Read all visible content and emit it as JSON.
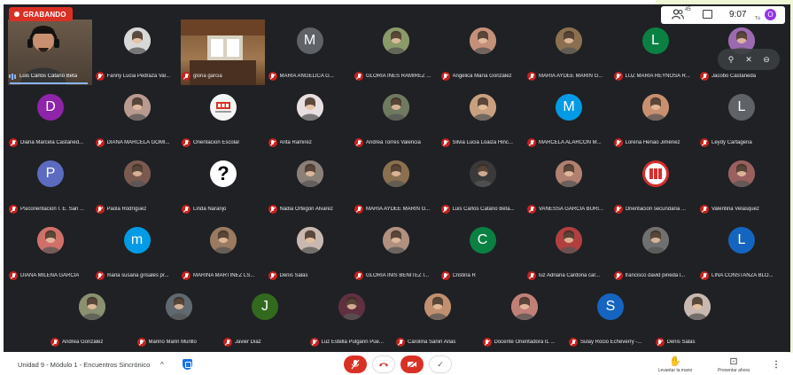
{
  "recording": {
    "label": "GRABANDO"
  },
  "topbar": {
    "participants_count": "45",
    "time": "9:07",
    "you_label": "Tú",
    "avatar_letter": "O"
  },
  "colors": {
    "background": "#202124",
    "recording": "#d93025",
    "mic_muted": "#c5221f",
    "speaking": "#8ab4f8"
  },
  "tiles": [
    {
      "name": "Luis Carlos Catano Beta",
      "avatar": "video-man-headphones",
      "color": "#5a4a3a",
      "speaking": true
    },
    {
      "name": "Fanny Lucia Pedraza Val...",
      "avatar": "photo",
      "color": "#d8d8d8"
    },
    {
      "name": "gloria garcia",
      "avatar": "video-room",
      "color": "#6b4a30"
    },
    {
      "name": "MARIA ANGELICA G...",
      "avatar": "M",
      "color": "#5f6368"
    },
    {
      "name": "GLORIA INÉS RAMÍREZ ...",
      "avatar": "photo",
      "color": "#8a9a6a"
    },
    {
      "name": "Angélica María González",
      "avatar": "photo",
      "color": "#c4907a"
    },
    {
      "name": "MARIA AYDEE MARIN G...",
      "avatar": "photo",
      "color": "#8a7050"
    },
    {
      "name": "LUZ MARIA REYNOSA R...",
      "avatar": "L",
      "color": "#0b8043"
    },
    {
      "name": "Jacobo Castañeda",
      "avatar": "photo",
      "color": "#9b6ab0"
    },
    {
      "name": "Diana Marcela Castañed...",
      "avatar": "D",
      "color": "#8e24aa"
    },
    {
      "name": "DIANA MARCELA GOMI...",
      "avatar": "photo",
      "color": "#b89a90"
    },
    {
      "name": "Orientacion Escolar",
      "avatar": "logo",
      "color": "#f4f4f4"
    },
    {
      "name": "Arita Ramirez",
      "avatar": "photo",
      "color": "#e8e0e0"
    },
    {
      "name": "Andrea Torres Valencia",
      "avatar": "photo",
      "color": "#707a60"
    },
    {
      "name": "Silvia Lucia Loaiza Hinc...",
      "avatar": "photo",
      "color": "#c8a080"
    },
    {
      "name": "MARCELA ALARCON M...",
      "avatar": "M",
      "color": "#039be5"
    },
    {
      "name": "Lorena Henao Jiménez",
      "avatar": "photo",
      "color": "#c89070"
    },
    {
      "name": "Leydy Cartagena",
      "avatar": "L",
      "color": "#5f6368"
    },
    {
      "name": "Psicorientacion I. E. San ...",
      "avatar": "P",
      "color": "#5c6bc0"
    },
    {
      "name": "Paola Rodríguez",
      "avatar": "photo",
      "color": "#7a5a50"
    },
    {
      "name": "Linda Naranjo",
      "avatar": "question",
      "color": "#ffffff"
    },
    {
      "name": "Nadia Ortegon Alvarez",
      "avatar": "photo",
      "color": "#8a8078"
    },
    {
      "name": "MARIA AYDEE MARIN G...",
      "avatar": "photo",
      "color": "#8a7050"
    },
    {
      "name": "Luis Carlos Catano Beta...",
      "avatar": "photo",
      "color": "#3a3a3a"
    },
    {
      "name": "VANESSA GARCIA BURI...",
      "avatar": "photo",
      "color": "#b08070"
    },
    {
      "name": "Orientacion secundaria ...",
      "avatar": "logo-red",
      "color": "#d32f2f"
    },
    {
      "name": "Valentina Velasquez",
      "avatar": "photo",
      "color": "#9a6060"
    },
    {
      "name": "DIANA MILENA GARCIA",
      "avatar": "photo",
      "color": "#d0706a"
    },
    {
      "name": "maria susana grisales pr...",
      "avatar": "m",
      "color": "#039be5"
    },
    {
      "name": "MARINA MARTÍNEZ LS...",
      "avatar": "photo",
      "color": "#9a7a60"
    },
    {
      "name": "Denis Salas",
      "avatar": "photo",
      "color": "#c8b8b0"
    },
    {
      "name": "GLORIA INIS BENITEZ I...",
      "avatar": "photo",
      "color": "#b09080"
    },
    {
      "name": "Cristina R",
      "avatar": "C",
      "color": "#0b8043"
    },
    {
      "name": "luz Adriana Cardona car...",
      "avatar": "photo",
      "color": "#b04040"
    },
    {
      "name": "francisco david pineda l...",
      "avatar": "photo",
      "color": "#707070"
    },
    {
      "name": "LINA CONSTANZA BLO...",
      "avatar": "L",
      "color": "#1565c0"
    },
    {
      "name": "Andrea González",
      "avatar": "photo",
      "color": "#8a9070"
    },
    {
      "name": "Marino Marin Murillo",
      "avatar": "photo",
      "color": "#606870"
    },
    {
      "name": "Javier Diaz",
      "avatar": "J",
      "color": "#33691e"
    },
    {
      "name": "Luz Estella Pulgarin Pue...",
      "avatar": "photo",
      "color": "#603040"
    },
    {
      "name": "Carolina Sanin Arias",
      "avatar": "photo",
      "color": "#c09070"
    },
    {
      "name": "Docente Orientadora IL ...",
      "avatar": "photo",
      "color": "#c08078"
    },
    {
      "name": "Sulay Rocio Echeverry -...",
      "avatar": "S",
      "color": "#1565c0"
    },
    {
      "name": "Denis Salas",
      "avatar": "photo",
      "color": "#c8b8b0"
    }
  ],
  "bottombar": {
    "meeting_title": "Unidad 9 - Módulo 1 - Encuentros Sincrónico",
    "raise_hand_label": "Levantar la mano",
    "present_label": "Presentar ahora"
  }
}
